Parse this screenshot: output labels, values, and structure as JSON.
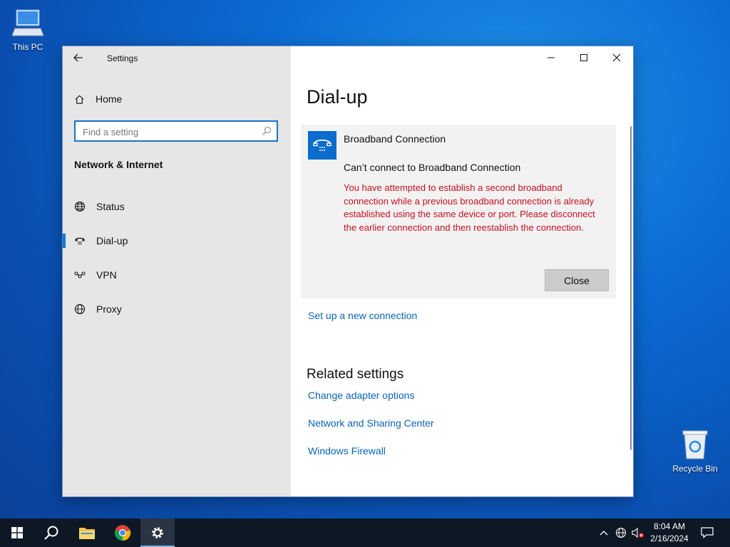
{
  "desktop": {
    "this_pc_label": "This PC",
    "recycle_bin_label": "Recycle Bin"
  },
  "window": {
    "app_title": "Settings",
    "nav": {
      "home_label": "Home",
      "search_placeholder": "Find a setting",
      "section_title": "Network & Internet",
      "items": [
        {
          "label": "Status"
        },
        {
          "label": "Dial-up"
        },
        {
          "label": "VPN"
        },
        {
          "label": "Proxy"
        }
      ]
    },
    "content": {
      "page_title": "Dial-up",
      "connection": {
        "name": "Broadband Connection",
        "error_title": "Can’t connect to Broadband Connection",
        "error_message": "You have attempted to establish a second broadband connection while a previous broadband connection is already established using the same device or port. Please disconnect the earlier connection and then reestablish the connection.",
        "close_label": "Close"
      },
      "setup_link": "Set up a new connection",
      "related_title": "Related settings",
      "related_links": [
        {
          "label": "Change adapter options"
        },
        {
          "label": "Network and Sharing Center"
        },
        {
          "label": "Windows Firewall"
        }
      ]
    }
  },
  "taskbar": {
    "time": "8:04 AM",
    "date": "2/16/2024"
  },
  "colors": {
    "accent": "#0078d7",
    "link": "#0a64b4",
    "error": "#c50f1f",
    "connection_tile": "#0a6ccc"
  }
}
